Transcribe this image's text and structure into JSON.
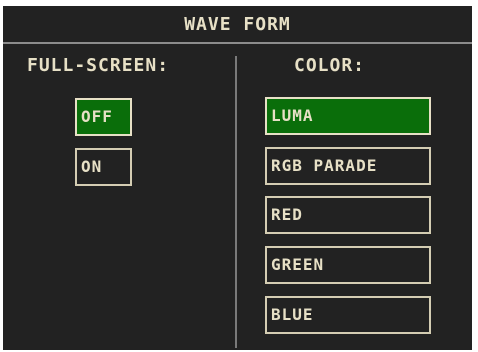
{
  "title": "WAVE FORM",
  "fullscreen": {
    "header": "FULL-SCREEN:",
    "options": [
      "OFF",
      "ON"
    ],
    "selected": "OFF"
  },
  "color": {
    "header": "COLOR:",
    "options": [
      "LUMA",
      "RGB PARADE",
      "RED",
      "GREEN",
      "BLUE"
    ],
    "selected": "LUMA"
  },
  "colors": {
    "background": "#222222",
    "text": "#e7e0c6",
    "selected": "#0a6e0a",
    "divider": "#8c8c8c"
  }
}
